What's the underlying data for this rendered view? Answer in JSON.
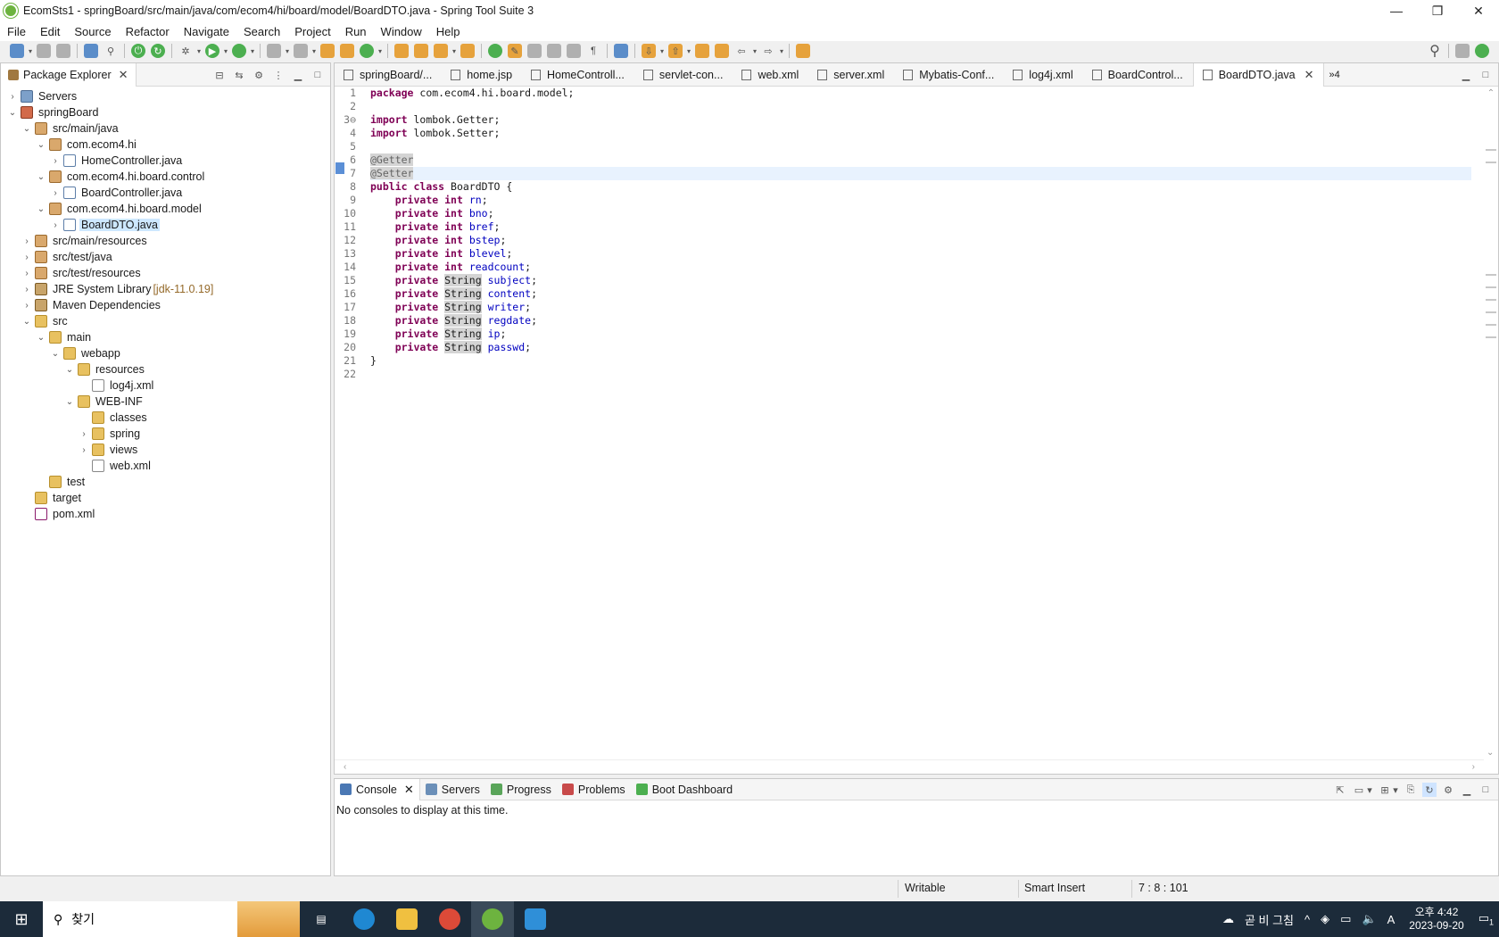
{
  "window": {
    "title": "EcomSts1 - springBoard/src/main/java/com/ecom4/hi/board/model/BoardDTO.java - Spring Tool Suite 3",
    "min_label": "—",
    "max_label": "❐",
    "close_label": "✕"
  },
  "menu": [
    "File",
    "Edit",
    "Source",
    "Refactor",
    "Navigate",
    "Search",
    "Project",
    "Run",
    "Window",
    "Help"
  ],
  "explorer": {
    "tab_label": "Package Explorer",
    "close": "✕",
    "items": [
      {
        "label": "Servers",
        "depth": 0,
        "arrow": "›",
        "icon": "srv"
      },
      {
        "label": "springBoard",
        "depth": 0,
        "arrow": "⌄",
        "icon": "proj"
      },
      {
        "label": "src/main/java",
        "depth": 1,
        "arrow": "⌄",
        "icon": "pkg"
      },
      {
        "label": "com.ecom4.hi",
        "depth": 2,
        "arrow": "⌄",
        "icon": "pkg"
      },
      {
        "label": "HomeController.java",
        "depth": 3,
        "arrow": "›",
        "icon": "java"
      },
      {
        "label": "com.ecom4.hi.board.control",
        "depth": 2,
        "arrow": "⌄",
        "icon": "pkg"
      },
      {
        "label": "BoardController.java",
        "depth": 3,
        "arrow": "›",
        "icon": "java"
      },
      {
        "label": "com.ecom4.hi.board.model",
        "depth": 2,
        "arrow": "⌄",
        "icon": "pkg"
      },
      {
        "label": "BoardDTO.java",
        "depth": 3,
        "arrow": "›",
        "icon": "java",
        "selected": true
      },
      {
        "label": "src/main/resources",
        "depth": 1,
        "arrow": "›",
        "icon": "pkg"
      },
      {
        "label": "src/test/java",
        "depth": 1,
        "arrow": "›",
        "icon": "pkg"
      },
      {
        "label": "src/test/resources",
        "depth": 1,
        "arrow": "›",
        "icon": "pkg"
      },
      {
        "label": "JRE System Library",
        "suffix": "[jdk-11.0.19]",
        "depth": 1,
        "arrow": "›",
        "icon": "lib"
      },
      {
        "label": "Maven Dependencies",
        "depth": 1,
        "arrow": "›",
        "icon": "lib"
      },
      {
        "label": "src",
        "depth": 1,
        "arrow": "⌄",
        "icon": "folder"
      },
      {
        "label": "main",
        "depth": 2,
        "arrow": "⌄",
        "icon": "folder"
      },
      {
        "label": "webapp",
        "depth": 3,
        "arrow": "⌄",
        "icon": "folder"
      },
      {
        "label": "resources",
        "depth": 4,
        "arrow": "⌄",
        "icon": "folder"
      },
      {
        "label": "log4j.xml",
        "depth": 5,
        "arrow": "",
        "icon": "xml"
      },
      {
        "label": "WEB-INF",
        "depth": 4,
        "arrow": "⌄",
        "icon": "folder"
      },
      {
        "label": "classes",
        "depth": 5,
        "arrow": "",
        "icon": "folder"
      },
      {
        "label": "spring",
        "depth": 5,
        "arrow": "›",
        "icon": "folder"
      },
      {
        "label": "views",
        "depth": 5,
        "arrow": "›",
        "icon": "folder"
      },
      {
        "label": "web.xml",
        "depth": 5,
        "arrow": "",
        "icon": "xml"
      },
      {
        "label": "test",
        "depth": 2,
        "arrow": "",
        "icon": "folder"
      },
      {
        "label": "target",
        "depth": 1,
        "arrow": "",
        "icon": "folder"
      },
      {
        "label": "pom.xml",
        "depth": 1,
        "arrow": "",
        "icon": "mvn"
      }
    ]
  },
  "editor": {
    "tabs": [
      {
        "label": "springBoard/...",
        "active": false
      },
      {
        "label": "home.jsp",
        "active": false
      },
      {
        "label": "HomeControll...",
        "active": false
      },
      {
        "label": "servlet-con...",
        "active": false
      },
      {
        "label": "web.xml",
        "active": false
      },
      {
        "label": "server.xml",
        "active": false
      },
      {
        "label": "Mybatis-Conf...",
        "active": false
      },
      {
        "label": "log4j.xml",
        "active": false
      },
      {
        "label": "BoardControl...",
        "active": false
      },
      {
        "label": "BoardDTO.java",
        "active": true
      }
    ],
    "overflow": "»4",
    "current_line": 7,
    "lines": [
      "package com.ecom4.hi.board.model;",
      "",
      "import lombok.Getter;",
      "import lombok.Setter;",
      "",
      "@Getter",
      "@Setter",
      "public class BoardDTO {",
      "    private int rn;",
      "    private int bno;",
      "    private int bref;",
      "    private int bstep;",
      "    private int blevel;",
      "    private int readcount;",
      "    private String subject;",
      "    private String content;",
      "    private String writer;",
      "    private String regdate;",
      "    private String ip;",
      "    private String passwd;",
      "}",
      ""
    ]
  },
  "console": {
    "tabs": [
      {
        "label": "Console",
        "active": true,
        "color": "#4a78b4"
      },
      {
        "label": "Servers",
        "active": false,
        "color": "#6b8fb8"
      },
      {
        "label": "Progress",
        "active": false,
        "color": "#5aa55a"
      },
      {
        "label": "Problems",
        "active": false,
        "color": "#c84a4a"
      },
      {
        "label": "Boot Dashboard",
        "active": false,
        "color": "#4caf50"
      }
    ],
    "message": "No consoles to display at this time."
  },
  "status": {
    "mode": "Writable",
    "insert": "Smart Insert",
    "position": "7 : 8 : 101"
  },
  "taskbar": {
    "search_placeholder": "찾기",
    "weather": "곧 비 그침",
    "time": "오후 4:42",
    "date": "2023-09-20",
    "ime": "A",
    "notif_count": "1"
  }
}
